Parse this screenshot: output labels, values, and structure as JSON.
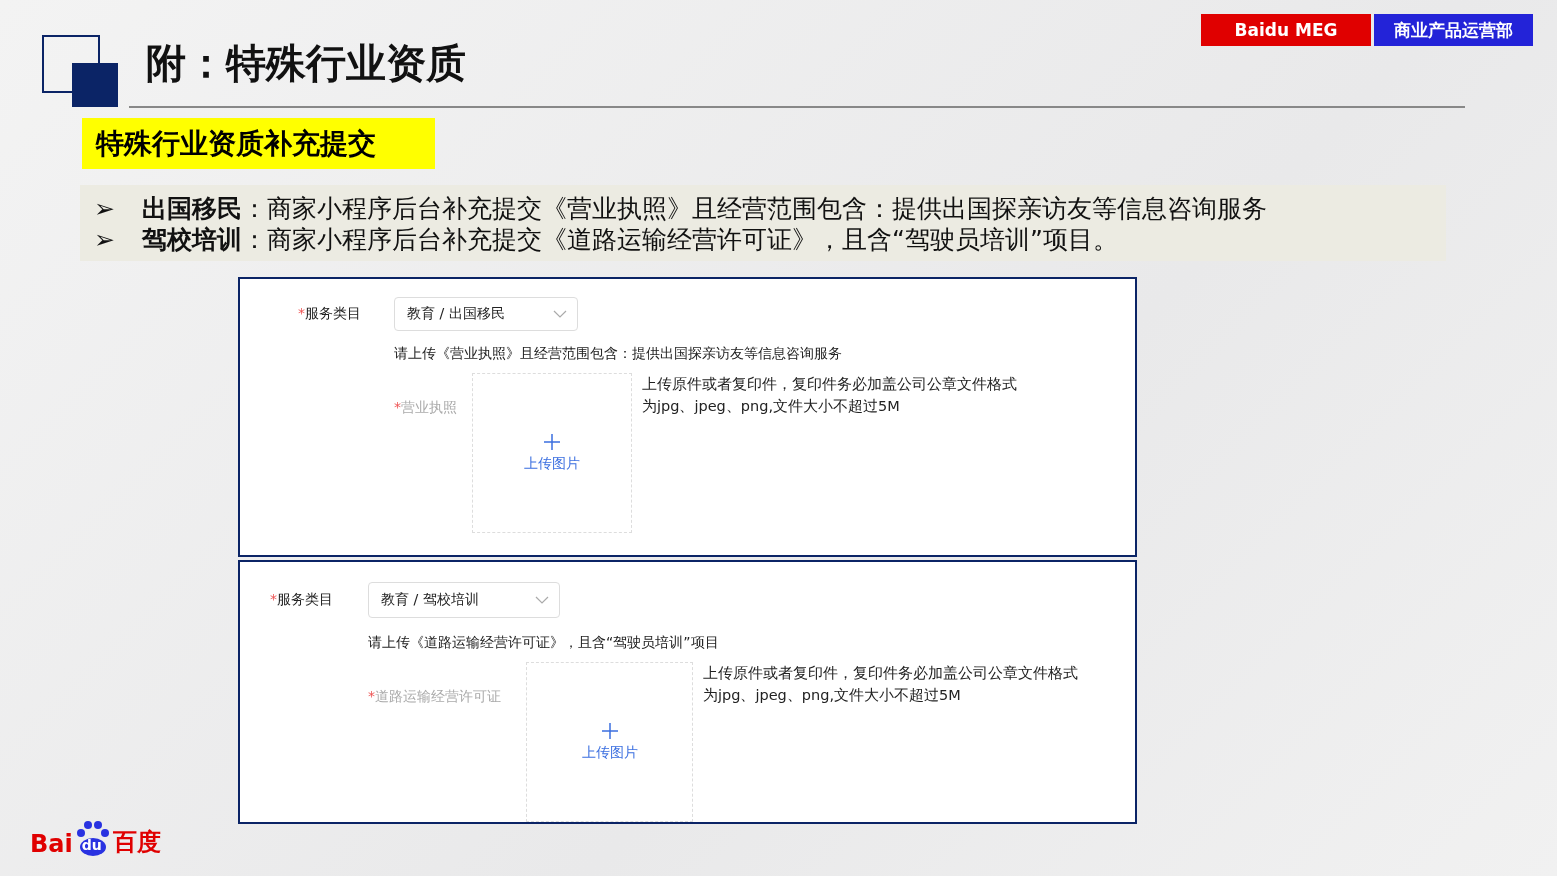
{
  "header": {
    "title": "附：特殊行业资质",
    "badges": [
      {
        "text": "Baidu MEG",
        "color": "#e00000"
      },
      {
        "text": "商业产品运营部",
        "color": "#2323d8"
      }
    ]
  },
  "section_label": "特殊行业资质补充提交",
  "bullets": [
    {
      "marker": "➢",
      "text": "**出国移民**：商家小程序后台补充提交《营业执照》且经营范围包含：提供出国探亲访友等信息咨询服务"
    },
    {
      "marker": "➢",
      "text": "**驾校培训**：商家小程序后台补充提交《道路运输经营许可证》，且含“驾驶员培训”项目。"
    }
  ],
  "forms": [
    {
      "category_label": "服务类目",
      "category_value": "教育 / 出国移民",
      "instruction": "请上传《营业执照》且经营范围包含：提供出国探亲访友等信息咨询服务",
      "upload_label": "营业执照",
      "upload_button": "上传图片",
      "hint_lines": [
        "上传原件或者复印件，复印件务必加盖公司公章文件格式",
        "为jpg、jpeg、png,文件大小不超过5M"
      ]
    },
    {
      "category_label": "服务类目",
      "category_value": "教育 / 驾校培训",
      "instruction": "请上传《道路运输经营许可证》，且含“驾驶员培训”项目",
      "upload_label": "道路运输经营许可证",
      "upload_button": "上传图片",
      "hint_lines": [
        "上传原件或者复印件，复印件务必加盖公司公章文件格式",
        "为jpg、jpeg、png,文件大小不超过5M"
      ]
    }
  ],
  "logo": {
    "left": "Bai",
    "paw": "du",
    "right": "百度"
  },
  "required_mark": "*"
}
